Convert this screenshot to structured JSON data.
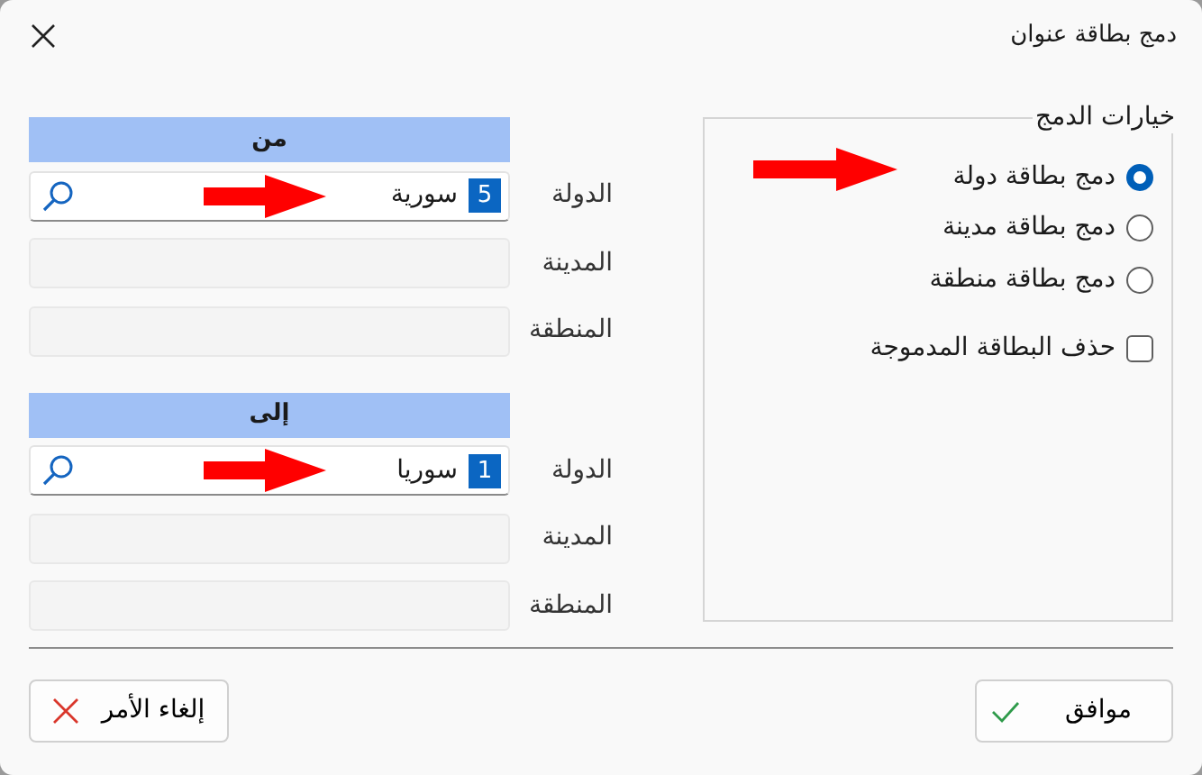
{
  "window": {
    "title": "دمج بطاقة عنوان"
  },
  "merge_options": {
    "title": "خيارات الدمج",
    "options": [
      {
        "label": "دمج بطاقة دولة",
        "selected": true
      },
      {
        "label": "دمج بطاقة مدينة",
        "selected": false
      },
      {
        "label": "دمج بطاقة منطقة",
        "selected": false
      }
    ],
    "delete_merged": {
      "label": "حذف البطاقة المدموجة",
      "checked": false
    }
  },
  "sections": [
    {
      "header": "من",
      "fields": [
        {
          "label": "الدولة",
          "kind": "lookup",
          "code": "5",
          "value": "سورية"
        },
        {
          "label": "المدينة",
          "kind": "text"
        },
        {
          "label": "المنطقة",
          "kind": "text"
        }
      ]
    },
    {
      "header": "إلى",
      "fields": [
        {
          "label": "الدولة",
          "kind": "lookup",
          "code": "1",
          "value": "سوريا"
        },
        {
          "label": "المدينة",
          "kind": "text"
        },
        {
          "label": "المنطقة",
          "kind": "text"
        }
      ]
    }
  ],
  "buttons": [
    {
      "label": "موافق",
      "kind": "ok"
    },
    {
      "label": "إلغاء الأمر",
      "kind": "cancel"
    }
  ]
}
